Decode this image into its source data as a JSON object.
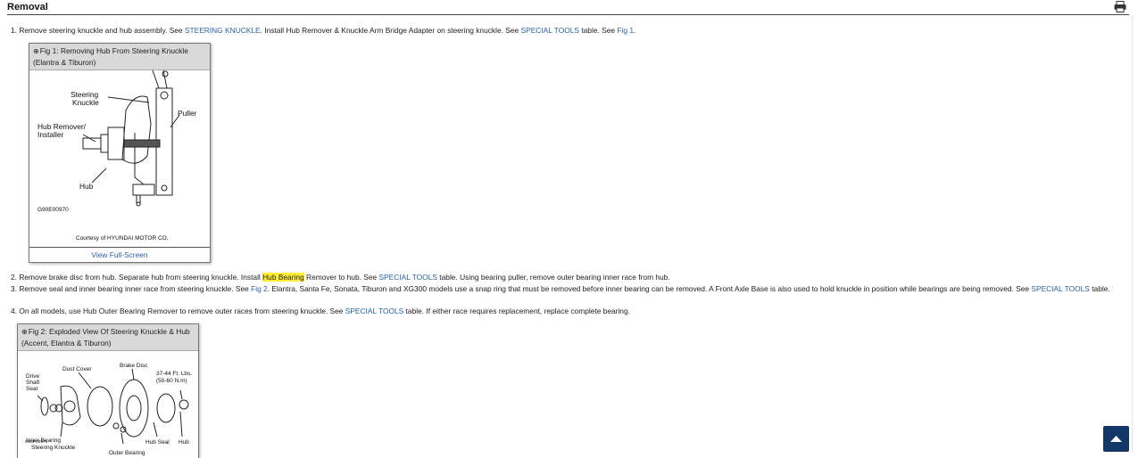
{
  "header": {
    "title": "Removal"
  },
  "steps": {
    "s1": {
      "num": "1.",
      "t1": " Remove steering knuckle and hub assembly. See ",
      "link1": "STEERING KNUCKLE",
      "t2": ". Install Hub Remover & Knuckle Arm Bridge Adapter on steering knuckle. See ",
      "link2": "SPECIAL TOOLS",
      "t3": " table. See ",
      "link3": "Fig 1",
      "t4": "."
    },
    "s2": {
      "num": "2.",
      "t1": " Remove brake disc from hub. Separate hub from steering knuckle. Install ",
      "highlight": "Hub Bearing",
      "t2": " Remover to hub. See ",
      "link1": "SPECIAL TOOLS",
      "t3": " table. Using bearing puller, remove outer bearing inner race from hub."
    },
    "s3": {
      "num": "3.",
      "t1": " Remove seal and inner bearing inner race from steering knuckle. See ",
      "link1": "Fig 2",
      "t2": ". Elantra, Santa Fe, Sonata, Tiburon and XG300 models use a snap ring that must be removed before inner bearing can be removed. A Front Axle Base is also used to hold knuckle in position while bearings are being removed. See ",
      "link2": "SPECIAL TOOLS",
      "t3": " table."
    },
    "s4": {
      "num": "4.",
      "t1": " On all models, use Hub Outer Bearing Remover to remove outer races from steering knuckle. See ",
      "link1": "SPECIAL TOOLS",
      "t2": " table. If either race requires replacement, replace complete bearing."
    }
  },
  "fig1": {
    "title": "Fig 1: Removing Hub From Steering Knuckle (Elantra & Tiburon)",
    "labels": {
      "steering": "Steering",
      "knuckle": "Knuckle",
      "puller": "Puller",
      "hub_remover": "Hub Remover/",
      "installer": "Installer",
      "hub": "Hub",
      "code": "G90E00970",
      "courtesy": "Courtesy of HYUNDAI MOTOR CO."
    },
    "view_full_screen": "View Full-Screen"
  },
  "fig2": {
    "title": "Fig 2: Exploded View Of Steering Knuckle & Hub (Accent, Elantra & Tiburon)",
    "labels": {
      "drive": "Drive",
      "shaft": "Shaft",
      "seal": "Seal",
      "dust_cover": "Dust Cover",
      "brake_disc": "Brake Disc",
      "torque1": "37-44 Ft. Lbs.",
      "torque2": "(50-60 N.m)",
      "inner_bearing": "Inner Bearing",
      "steering_knuckle": "Steering Knuckle",
      "hub_seal": "Hub Seal",
      "hub": "Hub",
      "outer_bearing": "Outer Bearing",
      "code": "G90F00971"
    }
  },
  "icons": {
    "print": "printer-icon",
    "zoom": "zoom-in-icon",
    "back_to_top": "chevron-up-icon"
  },
  "colors": {
    "link": "#2a64a6",
    "highlight": "#ffee33",
    "back_to_top": "#14376a"
  }
}
